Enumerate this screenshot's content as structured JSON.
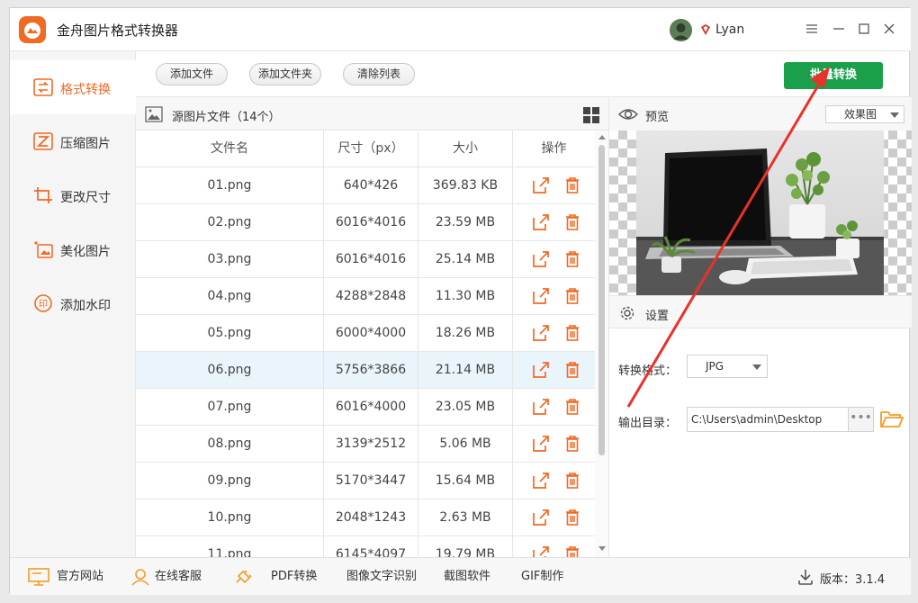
{
  "app": {
    "title": "金舟图片格式转换器",
    "username": "Lyan"
  },
  "sidebar": {
    "items": [
      {
        "label": "格式转换",
        "icon": "swap-icon",
        "active": true
      },
      {
        "label": "压缩图片",
        "icon": "compress-icon",
        "active": false
      },
      {
        "label": "更改尺寸",
        "icon": "crop-icon",
        "active": false
      },
      {
        "label": "美化图片",
        "icon": "beautify-icon",
        "active": false
      },
      {
        "label": "添加水印",
        "icon": "watermark-icon",
        "active": false
      }
    ]
  },
  "toolbar": {
    "add_file": "添加文件",
    "add_folder": "添加文件夹",
    "clear_list": "清除列表",
    "batch_convert": "批量转换"
  },
  "file_list": {
    "title": "源图片文件（14个）",
    "columns": [
      "文件名",
      "尺寸（px）",
      "大小",
      "操作"
    ],
    "rows": [
      {
        "name": "01.png",
        "size_px": "640*426",
        "size": "369.83 KB"
      },
      {
        "name": "02.png",
        "size_px": "6016*4016",
        "size": "23.59 MB"
      },
      {
        "name": "03.png",
        "size_px": "6016*4016",
        "size": "25.14 MB"
      },
      {
        "name": "04.png",
        "size_px": "4288*2848",
        "size": "11.30 MB"
      },
      {
        "name": "05.png",
        "size_px": "6000*4000",
        "size": "18.26 MB"
      },
      {
        "name": "06.png",
        "size_px": "5756*3866",
        "size": "21.14 MB"
      },
      {
        "name": "07.png",
        "size_px": "6016*4000",
        "size": "23.05 MB"
      },
      {
        "name": "08.png",
        "size_px": "3139*2512",
        "size": "5.06 MB"
      },
      {
        "name": "09.png",
        "size_px": "5170*3447",
        "size": "15.64 MB"
      },
      {
        "name": "10.png",
        "size_px": "2048*1243",
        "size": "2.63 MB"
      },
      {
        "name": "11.png",
        "size_px": "6145*4097",
        "size": "19.79 MB"
      }
    ],
    "selected_row": "06.png"
  },
  "preview": {
    "title": "预览",
    "mode": "效果图"
  },
  "settings": {
    "title": "设置",
    "format_label": "转换格式：",
    "format_value": "JPG",
    "output_label": "输出目录：",
    "output_path": "C:\\Users\\admin\\Desktop",
    "more_btn": "•••"
  },
  "footer": {
    "items": [
      "官方网站",
      "在线客服",
      "PDF转换",
      "图像文字识别",
      "截图软件",
      "GIF制作"
    ],
    "version": "版本：3.1.4"
  },
  "colors": {
    "accent": "#f06a24",
    "primary_button": "#1aa04a",
    "annotation": "#e8322a",
    "selected_row": "#eaf4fb"
  }
}
